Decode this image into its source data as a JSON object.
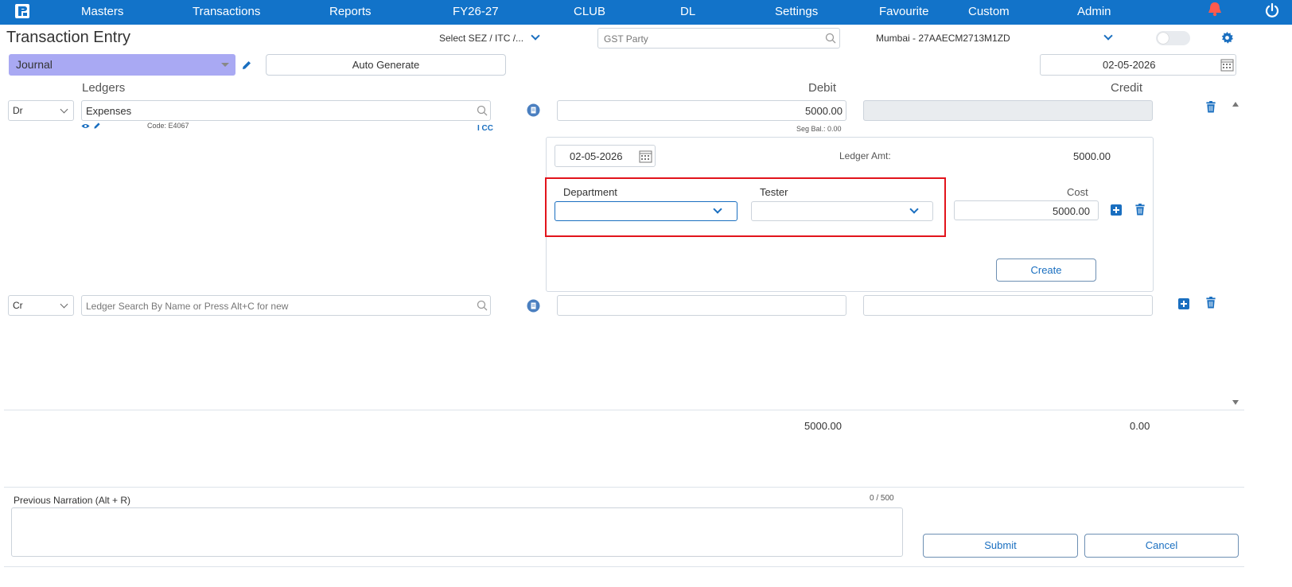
{
  "nav": {
    "items": [
      "Masters",
      "Transactions",
      "Reports",
      "FY26-27",
      "CLUB",
      "DL",
      "Settings",
      "Favourite",
      "Custom",
      "Admin"
    ]
  },
  "header": {
    "title": "Transaction Entry",
    "sez_select": "Select SEZ / ITC /...",
    "gst_party_placeholder": "GST Party",
    "branch": "Mumbai - 27AAECM2713M1ZD"
  },
  "toolbar": {
    "voucher_type": "Journal",
    "auto_generate": "Auto Generate",
    "date": "02-05-2026"
  },
  "columns": {
    "ledgers": "Ledgers",
    "debit": "Debit",
    "credit": "Credit"
  },
  "row1": {
    "drcr": "Dr",
    "ledger": "Expenses",
    "code": "Code: E4067",
    "icc": "I CC",
    "debit": "5000.00",
    "seg_bal": "Seg Bal.: 0.00"
  },
  "cost_panel": {
    "date": "02-05-2026",
    "ledger_amt_label": "Ledger Amt:",
    "ledger_amt": "5000.00",
    "department_label": "Department",
    "tester_label": "Tester",
    "cost_label": "Cost",
    "cost_value": "5000.00",
    "create": "Create"
  },
  "row2": {
    "drcr": "Cr",
    "ledger_placeholder": "Ledger Search By Name or Press Alt+C for new"
  },
  "totals": {
    "debit": "5000.00",
    "credit": "0.00"
  },
  "narration": {
    "label": "Previous Narration (Alt + R)",
    "counter": "0 / 500"
  },
  "actions": {
    "submit": "Submit",
    "cancel": "Cancel"
  },
  "colors": {
    "nav_bg": "#1273c9",
    "journal_bg": "#a9a9f3",
    "accent": "#1a6fc0",
    "highlight": "#e2141c"
  }
}
